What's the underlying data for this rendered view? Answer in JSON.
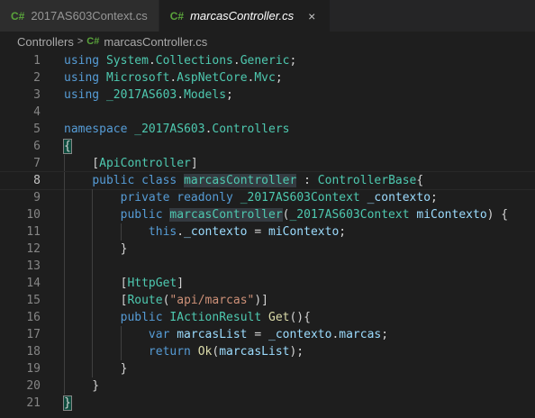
{
  "tabs": [
    {
      "lang": "C#",
      "name": "2017AS603Context.cs",
      "active": false
    },
    {
      "lang": "C#",
      "name": "marcasController.cs",
      "active": true,
      "close": "×"
    }
  ],
  "breadcrumb": {
    "folder": "Controllers",
    "separator": ">",
    "lang": "C#",
    "file": "marcasController.cs"
  },
  "editor": {
    "current_line": 8,
    "line_numbers": [
      "1",
      "2",
      "3",
      "4",
      "5",
      "6",
      "7",
      "8",
      "9",
      "10",
      "11",
      "12",
      "13",
      "14",
      "15",
      "16",
      "17",
      "18",
      "19",
      "20",
      "21"
    ],
    "colors": {
      "keyword": "#569cd6",
      "type": "#4ec9b0",
      "function": "#dcdcaa",
      "variable": "#9cdcfe",
      "string": "#ce9178",
      "plain": "#d4d4d4"
    },
    "lines": [
      [
        {
          "t": "kw",
          "v": "using"
        },
        {
          "t": "pl",
          "v": " "
        },
        {
          "t": "ns",
          "v": "System"
        },
        {
          "t": "pl",
          "v": "."
        },
        {
          "t": "ns",
          "v": "Collections"
        },
        {
          "t": "pl",
          "v": "."
        },
        {
          "t": "ns",
          "v": "Generic"
        },
        {
          "t": "pl",
          "v": ";"
        }
      ],
      [
        {
          "t": "kw",
          "v": "using"
        },
        {
          "t": "pl",
          "v": " "
        },
        {
          "t": "ns",
          "v": "Microsoft"
        },
        {
          "t": "pl",
          "v": "."
        },
        {
          "t": "ns",
          "v": "AspNetCore"
        },
        {
          "t": "pl",
          "v": "."
        },
        {
          "t": "ns",
          "v": "Mvc"
        },
        {
          "t": "pl",
          "v": ";"
        }
      ],
      [
        {
          "t": "kw",
          "v": "using"
        },
        {
          "t": "pl",
          "v": " "
        },
        {
          "t": "ns",
          "v": "_2017AS603"
        },
        {
          "t": "pl",
          "v": "."
        },
        {
          "t": "ns",
          "v": "Models"
        },
        {
          "t": "pl",
          "v": ";"
        }
      ],
      [],
      [
        {
          "t": "kw",
          "v": "namespace"
        },
        {
          "t": "pl",
          "v": " "
        },
        {
          "t": "ns",
          "v": "_2017AS603"
        },
        {
          "t": "pl",
          "v": "."
        },
        {
          "t": "ns",
          "v": "Controllers"
        }
      ],
      [
        {
          "t": "br",
          "v": "{"
        }
      ],
      [
        {
          "t": "pl",
          "v": "    ["
        },
        {
          "t": "ty",
          "v": "ApiController"
        },
        {
          "t": "pl",
          "v": "]"
        }
      ],
      [
        {
          "t": "pl",
          "v": "    "
        },
        {
          "t": "kw",
          "v": "public"
        },
        {
          "t": "pl",
          "v": " "
        },
        {
          "t": "kw",
          "v": "class"
        },
        {
          "t": "pl",
          "v": " "
        },
        {
          "t": "tyhl",
          "v": "marcasController"
        },
        {
          "t": "pl",
          "v": " : "
        },
        {
          "t": "ty",
          "v": "ControllerBase"
        },
        {
          "t": "pl",
          "v": "{"
        }
      ],
      [
        {
          "t": "pl",
          "v": "        "
        },
        {
          "t": "kw",
          "v": "private"
        },
        {
          "t": "pl",
          "v": " "
        },
        {
          "t": "kw",
          "v": "readonly"
        },
        {
          "t": "pl",
          "v": " "
        },
        {
          "t": "ty",
          "v": "_2017AS603Context"
        },
        {
          "t": "pl",
          "v": " "
        },
        {
          "t": "var",
          "v": "_contexto"
        },
        {
          "t": "pl",
          "v": ";"
        }
      ],
      [
        {
          "t": "pl",
          "v": "        "
        },
        {
          "t": "kw",
          "v": "public"
        },
        {
          "t": "pl",
          "v": " "
        },
        {
          "t": "tyhl",
          "v": "marcasController"
        },
        {
          "t": "pl",
          "v": "("
        },
        {
          "t": "ty",
          "v": "_2017AS603Context"
        },
        {
          "t": "pl",
          "v": " "
        },
        {
          "t": "var",
          "v": "miContexto"
        },
        {
          "t": "pl",
          "v": ") {"
        }
      ],
      [
        {
          "t": "pl",
          "v": "            "
        },
        {
          "t": "kw",
          "v": "this"
        },
        {
          "t": "pl",
          "v": "."
        },
        {
          "t": "var",
          "v": "_contexto"
        },
        {
          "t": "pl",
          "v": " = "
        },
        {
          "t": "var",
          "v": "miContexto"
        },
        {
          "t": "pl",
          "v": ";"
        }
      ],
      [
        {
          "t": "pl",
          "v": "        }"
        }
      ],
      [],
      [
        {
          "t": "pl",
          "v": "        ["
        },
        {
          "t": "ty",
          "v": "HttpGet"
        },
        {
          "t": "pl",
          "v": "]"
        }
      ],
      [
        {
          "t": "pl",
          "v": "        ["
        },
        {
          "t": "ty",
          "v": "Route"
        },
        {
          "t": "pl",
          "v": "("
        },
        {
          "t": "str",
          "v": "\"api/marcas\""
        },
        {
          "t": "pl",
          "v": ")]"
        }
      ],
      [
        {
          "t": "pl",
          "v": "        "
        },
        {
          "t": "kw",
          "v": "public"
        },
        {
          "t": "pl",
          "v": " "
        },
        {
          "t": "ty",
          "v": "IActionResult"
        },
        {
          "t": "pl",
          "v": " "
        },
        {
          "t": "fn",
          "v": "Get"
        },
        {
          "t": "pl",
          "v": "(){"
        }
      ],
      [
        {
          "t": "pl",
          "v": "            "
        },
        {
          "t": "kw",
          "v": "var"
        },
        {
          "t": "pl",
          "v": " "
        },
        {
          "t": "var",
          "v": "marcasList"
        },
        {
          "t": "pl",
          "v": " = "
        },
        {
          "t": "var",
          "v": "_contexto"
        },
        {
          "t": "pl",
          "v": "."
        },
        {
          "t": "var",
          "v": "marcas"
        },
        {
          "t": "pl",
          "v": ";"
        }
      ],
      [
        {
          "t": "pl",
          "v": "            "
        },
        {
          "t": "kw",
          "v": "return"
        },
        {
          "t": "pl",
          "v": " "
        },
        {
          "t": "fn",
          "v": "Ok"
        },
        {
          "t": "pl",
          "v": "("
        },
        {
          "t": "var",
          "v": "marcasList"
        },
        {
          "t": "pl",
          "v": ");"
        }
      ],
      [
        {
          "t": "pl",
          "v": "        }"
        }
      ],
      [
        {
          "t": "pl",
          "v": "    }"
        }
      ],
      [
        {
          "t": "br",
          "v": "}"
        }
      ]
    ]
  }
}
